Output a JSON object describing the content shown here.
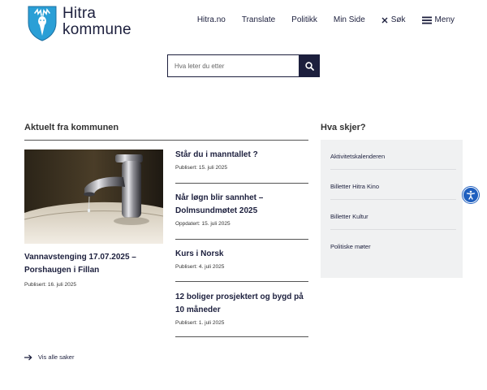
{
  "logo": {
    "line1": "Hitra",
    "line2": "kommune"
  },
  "nav": {
    "links": [
      "Hitra.no",
      "Translate",
      "Politikk",
      "Min Side"
    ],
    "search_label": "Søk",
    "menu_label": "Meny"
  },
  "search": {
    "placeholder": "Hva leter du etter"
  },
  "news": {
    "heading": "Aktuelt fra kommunen",
    "featured": {
      "title": "Vannavstenging 17.07.2025 – Porshaugen i Fillan",
      "date": "Publisert: 16. juli 2025"
    },
    "items": [
      {
        "title": "Står du i manntallet ?",
        "date": "Publisert: 15. juli 2025"
      },
      {
        "title": "Når løgn blir sannhet – Dolmsundmøtet 2025",
        "date": "Oppdatert: 15. juli 2025"
      },
      {
        "title": "Kurs i Norsk",
        "date": "Publisert: 4. juli 2025"
      },
      {
        "title": "12 boliger prosjektert og bygd på 10 måneder",
        "date": "Publisert: 1. juli 2025"
      }
    ],
    "view_all": "Vis alle saker"
  },
  "events": {
    "heading": "Hva skjer?",
    "links": [
      "Aktivitetskalenderen",
      "Billetter Hitra Kino",
      "Billetter Kultur",
      "Politiske møter"
    ]
  },
  "colors": {
    "primary": "#1c1f3d",
    "logo_blue": "#2a9fd6",
    "accessibility": "#1f5fbf",
    "panel_bg": "#f0f1f2"
  }
}
